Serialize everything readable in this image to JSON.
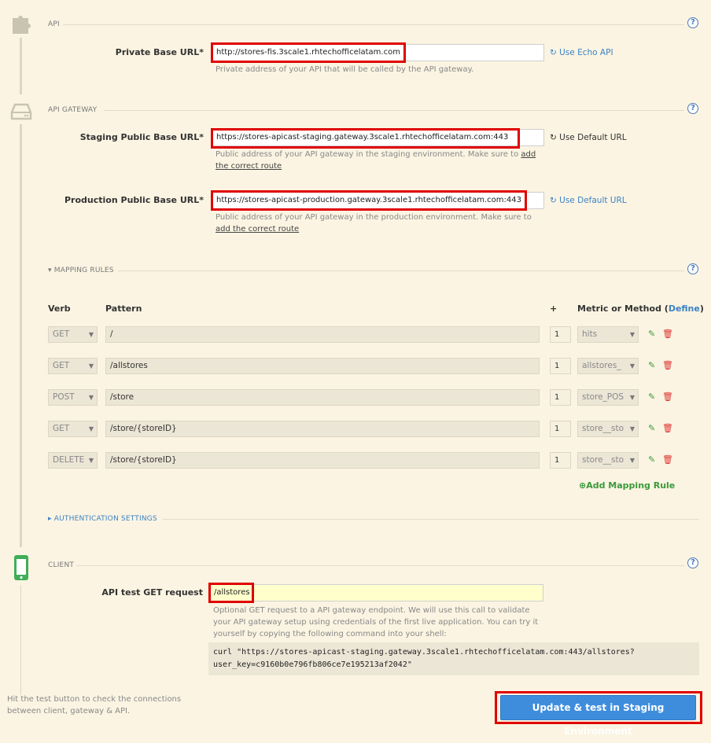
{
  "icons": {
    "api": "puzzle-icon",
    "gateway": "server-icon",
    "client": "mobile-phone-icon",
    "help": "help-circle-icon",
    "reset": "refresh-icon",
    "edit": "pencil-icon",
    "delete": "trash-icon",
    "add": "plus-circle-icon"
  },
  "colors": {
    "background": "#fbf4e2",
    "link": "#3b82c4",
    "highlight": "#e00000",
    "primary": "#3e8ddd",
    "success": "#3a9a3a",
    "danger": "#dd3333"
  },
  "api": {
    "section_title": "API",
    "help": "?",
    "private_label": "Private Base URL",
    "required": "*",
    "private_value": "http://stores-fis.3scale1.rhtechofficelatam.com",
    "private_hint": "Private address of your API that will be called by the API gateway.",
    "echo_link": "Use Echo API"
  },
  "gateway": {
    "section_title": "API GATEWAY",
    "help": "?",
    "staging_label": "Staging Public Base URL",
    "staging_value": "https://stores-apicast-staging.gateway.3scale1.rhtechofficelatam.com:443",
    "staging_hint": "Public address of your API gateway in the staging environment. Make sure to",
    "staging_hint_link": "add the correct route",
    "staging_default": "Use Default URL",
    "production_label": "Production Public Base URL",
    "production_value": "https://stores-apicast-production.gateway.3scale1.rhtechofficelatam.com:443",
    "production_hint": "Public address of your API gateway in the production environment. Make sure to",
    "production_hint_link": "add the correct route",
    "production_default": "Use Default URL"
  },
  "mapping": {
    "section_title": "MAPPING RULES",
    "help": "?",
    "headers": {
      "verb": "Verb",
      "pattern": "Pattern",
      "plus": "+",
      "metric": "Metric or Method (",
      "define": "Define",
      "metric_close": ")"
    },
    "rules": [
      {
        "verb": "GET",
        "pattern": "/",
        "delta": "1",
        "metric": "hits"
      },
      {
        "verb": "GET",
        "pattern": "/allstores",
        "delta": "1",
        "metric": "allstores_"
      },
      {
        "verb": "POST",
        "pattern": "/store",
        "delta": "1",
        "metric": "store_POS"
      },
      {
        "verb": "GET",
        "pattern": "/store/{storeID}",
        "delta": "1",
        "metric": "store__sto"
      },
      {
        "verb": "DELETE",
        "pattern": "/store/{storeID}",
        "delta": "1",
        "metric": "store__sto"
      }
    ],
    "add_rule": "Add Mapping Rule"
  },
  "auth": {
    "section_title": "AUTHENTICATION SETTINGS"
  },
  "client": {
    "section_title": "CLIENT",
    "help": "?",
    "test_label": "API test GET request",
    "test_value": "/allstores",
    "test_hint": "Optional GET request to a API gateway endpoint. We will use this call to validate your API gateway setup using credentials of the first live application. You can try it yourself by copying the following command into your shell:",
    "curl_line1": "curl \"https://stores-apicast-staging.gateway.3scale1.rhtechofficelatam.com:443/allstores?",
    "curl_line2": "user_key=c9160b0e796fb806ce7e195213af2042\""
  },
  "footer": {
    "hint": "Hit the test button to check the connections between client, gateway & API.",
    "submit": "Update & test in Staging Environment"
  }
}
